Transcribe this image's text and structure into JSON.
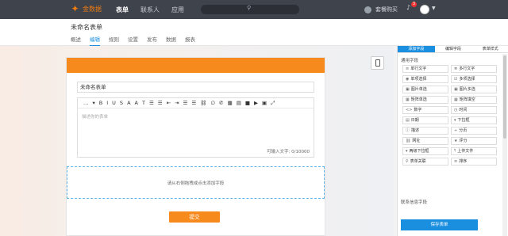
{
  "app": {
    "brand": "金数据",
    "nav": [
      "表单",
      "联系人",
      "应用"
    ],
    "upgrade": "套餐购买",
    "notification_count": "3"
  },
  "header": {
    "form_title": "未命名表单",
    "tabs": [
      "概述",
      "编辑",
      "规则",
      "设置",
      "发布",
      "数据",
      "报表"
    ],
    "active_tab": "编辑"
  },
  "form": {
    "name_value": "未命名表单",
    "toolbar": [
      "…",
      "▾",
      "B",
      "I",
      "U",
      "S",
      "A",
      "A",
      "T",
      "☰",
      "☰",
      "⇤",
      "⇥",
      "☰",
      "☰",
      "⛓",
      "∅",
      "✆",
      "▦",
      "▤",
      "■",
      "▶",
      "▣",
      "⤢"
    ],
    "description_placeholder": "描述你的表单",
    "char_counter": "可输入文字: 0/10000",
    "drop_hint": "请从右侧拖拽或点击添加字段",
    "submit_label": "提交"
  },
  "panel": {
    "tabs": [
      "添加字段",
      "编辑字段",
      "表单样式"
    ],
    "active_tab": "添加字段",
    "section_common": "通用字段",
    "fields": [
      {
        "icon": "≡",
        "label": "单行文字"
      },
      {
        "icon": "≣",
        "label": "多行文字"
      },
      {
        "icon": "◉",
        "label": "单项选择"
      },
      {
        "icon": "☑",
        "label": "多项选择"
      },
      {
        "icon": "▣",
        "label": "图片单选"
      },
      {
        "icon": "▣",
        "label": "图片多选"
      },
      {
        "icon": "▦",
        "label": "矩阵单选"
      },
      {
        "icon": "▦",
        "label": "矩阵填空"
      },
      {
        "icon": "<>",
        "label": "数字"
      },
      {
        "icon": "◷",
        "label": "时间"
      },
      {
        "icon": "▤",
        "label": "日期"
      },
      {
        "icon": "▾",
        "label": "下拉框"
      },
      {
        "icon": "ⓘ",
        "label": "描述"
      },
      {
        "icon": "÷",
        "label": "分页"
      },
      {
        "icon": "⛓",
        "label": "网址"
      },
      {
        "icon": "★",
        "label": "评分"
      },
      {
        "icon": "▾",
        "label": "两级下拉框"
      },
      {
        "icon": "⤒",
        "label": "上传文件"
      },
      {
        "icon": "⚲",
        "label": "表单关联"
      },
      {
        "icon": "≡",
        "label": "排序"
      }
    ],
    "section_contact": "联系信息字段",
    "save_label": "保存表单"
  }
}
